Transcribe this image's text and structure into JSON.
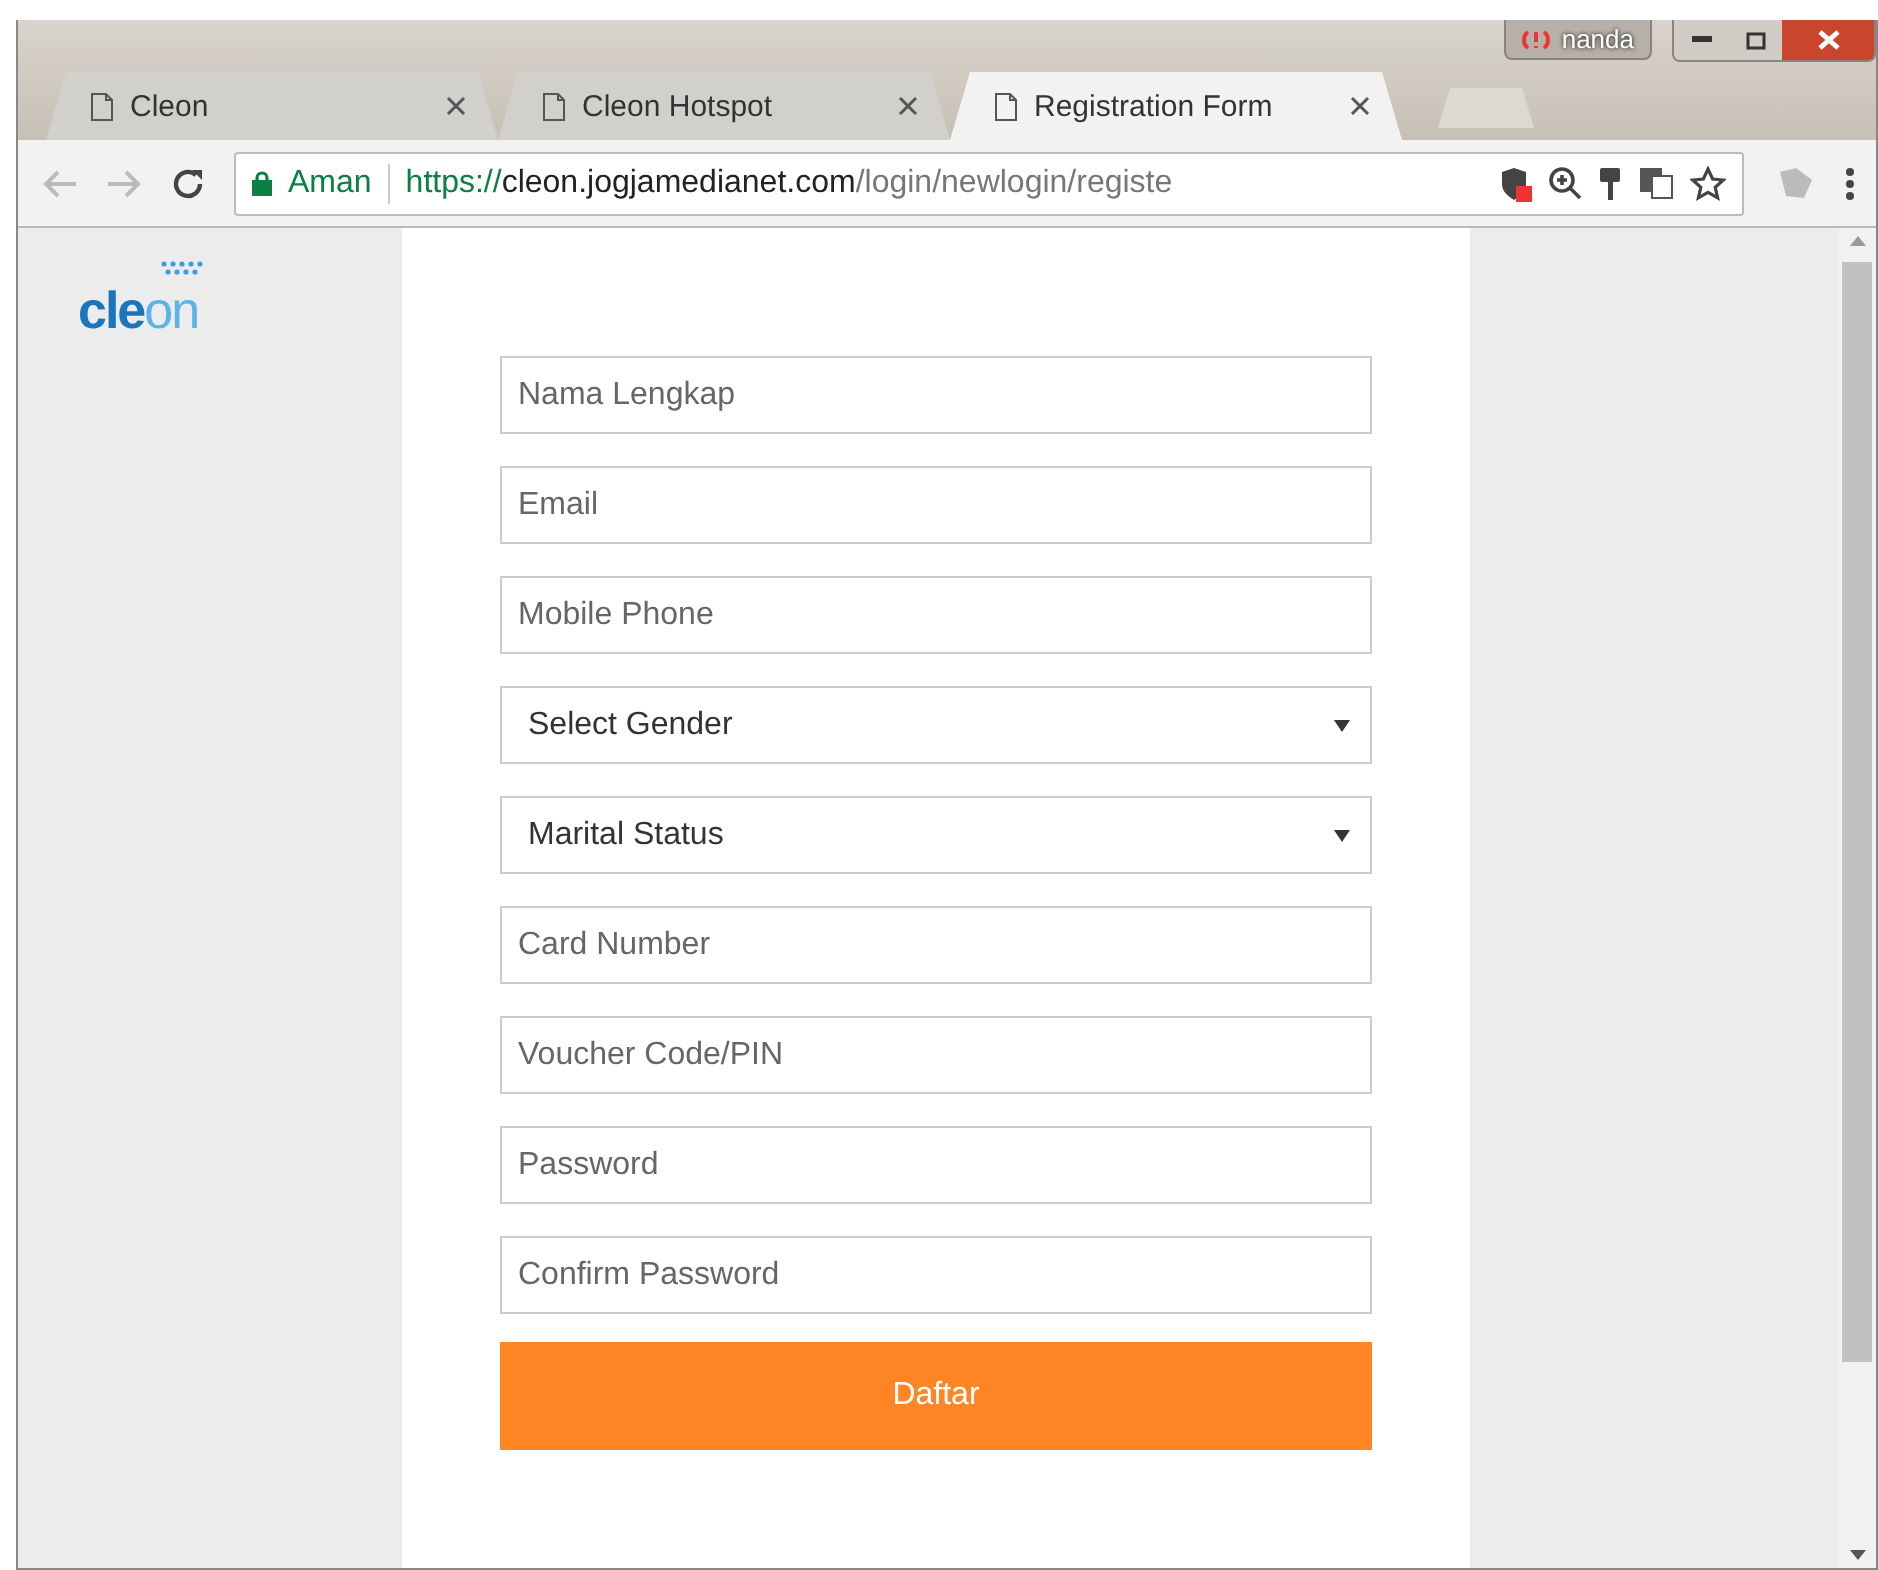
{
  "window": {
    "profile": "nanda"
  },
  "tabs": [
    {
      "title": "Cleon",
      "selected": false
    },
    {
      "title": "Cleon Hotspot",
      "selected": false
    },
    {
      "title": "Registration Form",
      "selected": true
    }
  ],
  "toolbar": {
    "security_label": "Aman",
    "url": {
      "scheme": "https://",
      "host": "cleon.jogjamedianet.com",
      "path": "/login/newlogin/registe"
    }
  },
  "logo": {
    "part_1": "cle",
    "part_2": "on"
  },
  "form": {
    "fields": [
      {
        "kind": "input",
        "placeholder": "Nama Lengkap"
      },
      {
        "kind": "input",
        "placeholder": "Email"
      },
      {
        "kind": "input",
        "placeholder": "Mobile Phone"
      },
      {
        "kind": "select",
        "value": "Select Gender"
      },
      {
        "kind": "select",
        "value": "Marital Status"
      },
      {
        "kind": "input",
        "placeholder": "Card Number"
      },
      {
        "kind": "input",
        "placeholder": "Voucher Code/PIN"
      },
      {
        "kind": "input",
        "placeholder": "Password"
      },
      {
        "kind": "input",
        "placeholder": "Confirm Password"
      }
    ],
    "submit": "Daftar"
  }
}
